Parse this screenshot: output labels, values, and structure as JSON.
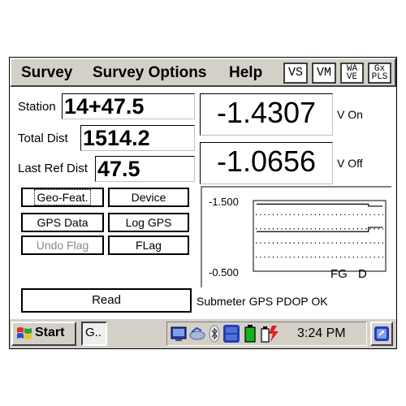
{
  "menu": {
    "survey": "Survey",
    "survey_options": "Survey Options",
    "help": "Help"
  },
  "toolbar": {
    "vs": "VS",
    "vm": "VM",
    "wave": "WA VE",
    "gxpls": "Gx PLS"
  },
  "fields": {
    "station_label": "Station",
    "station_value": "14+47.5",
    "total_dist_label": "Total Dist",
    "total_dist_value": "1514.2",
    "last_ref_label": "Last Ref Dist",
    "last_ref_value": "47.5"
  },
  "readings": {
    "von_value": "-1.4307",
    "von_unit": "V On",
    "voff_value": "-1.0656",
    "voff_unit": "V Off"
  },
  "buttons": {
    "geo_feat": "Geo-Feat.",
    "device": "Device",
    "gps_data": "GPS Data",
    "log_gps": "Log GPS",
    "undo_flag": "Undo Flag",
    "flag": "FLag",
    "read": "Read"
  },
  "chart_data": {
    "type": "line",
    "ylim": [
      -0.5,
      -1.5
    ],
    "tick_labels": [
      "-1.500",
      "-0.500"
    ],
    "annotations": [
      "FG",
      "D"
    ],
    "series": [
      {
        "values": [
          -1.45,
          -1.45,
          -1.45,
          -1.45,
          -1.45,
          -1.45,
          -1.45,
          -1.45,
          -1.42,
          -1.42
        ]
      },
      {
        "values": [
          -1.06,
          -1.06,
          -1.06,
          -1.06,
          -1.06,
          -1.06,
          -1.06,
          -1.06,
          -1.12,
          -1.12
        ]
      }
    ]
  },
  "status": "Submeter GPS PDOP OK",
  "taskbar": {
    "start": "Start",
    "task_label": "G..",
    "clock": "3:24 PM"
  },
  "icons": [
    "windows-flag-icon",
    "network-icon",
    "sync-icon",
    "bluetooth-icon",
    "gps-icon",
    "battery-icon",
    "power-icon",
    "desktop-icon"
  ],
  "colors": {
    "chrome": "#d4d0c8",
    "accent_blue": "#1f3fbf",
    "battery_green": "#12b21a",
    "power_red": "#e02020"
  }
}
